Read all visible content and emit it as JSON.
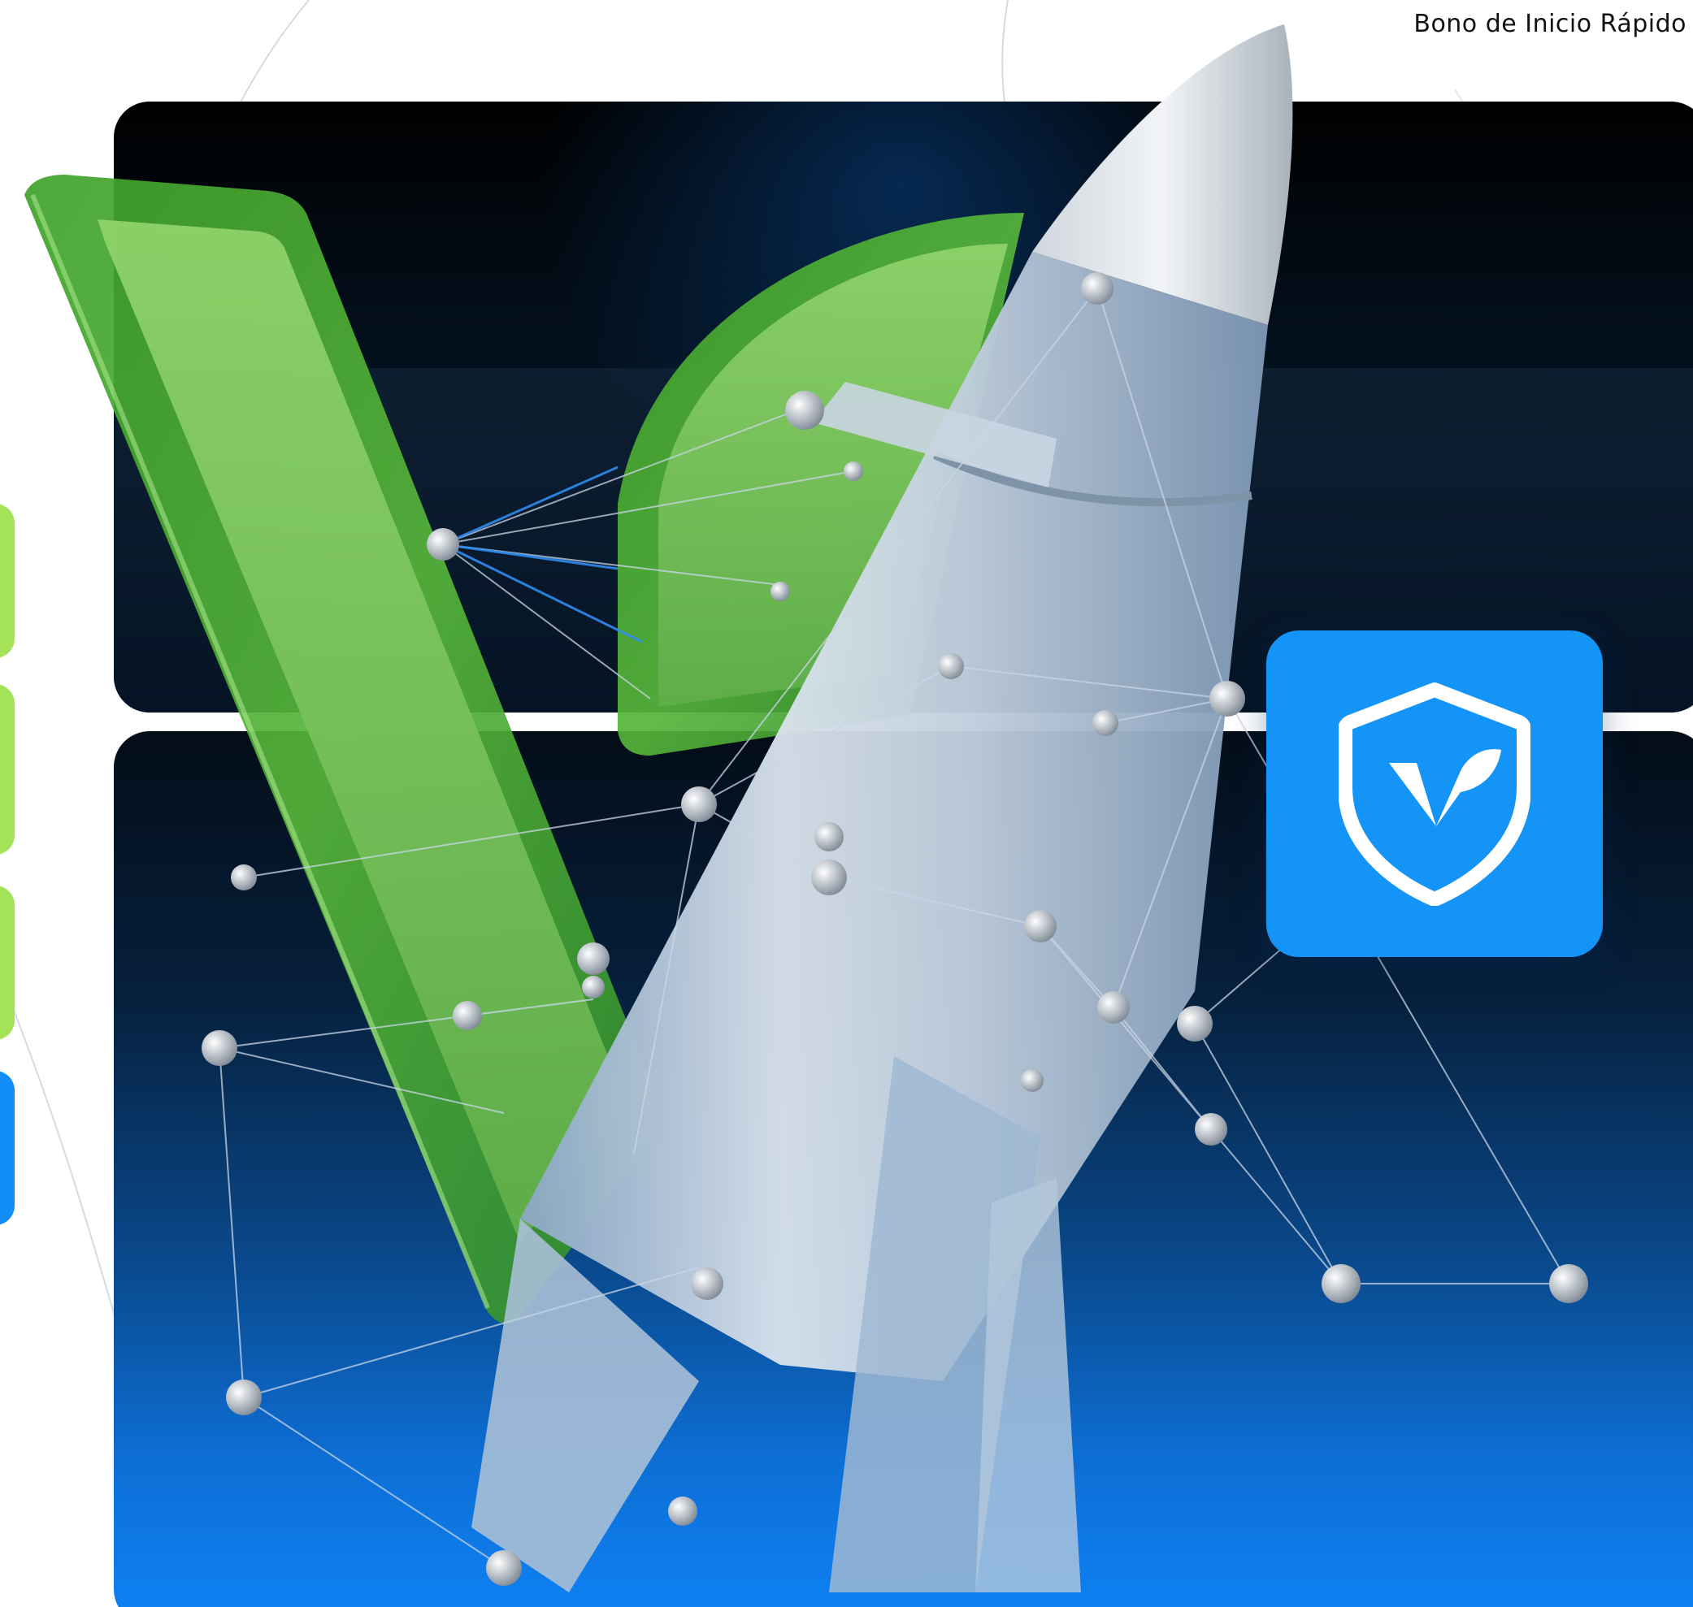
{
  "header": {
    "title": "Bono de Inicio Rápido"
  },
  "colors": {
    "accent_blue": "#1594f7",
    "accent_green": "#a4e25a",
    "panel_dark": "#03101d"
  },
  "icons": {
    "shield": "shield-leaf-logo-icon"
  },
  "illustration": {
    "subject": "rocket-network-graphic"
  }
}
